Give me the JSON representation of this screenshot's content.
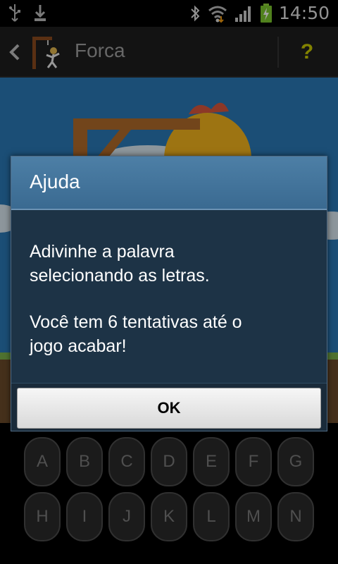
{
  "status_bar": {
    "time": "14:50",
    "left_icons": [
      "usb-icon",
      "download-icon"
    ],
    "right_icons": [
      "bluetooth-icon",
      "wifi-icon",
      "signal-icon",
      "battery-charging-icon"
    ]
  },
  "action_bar": {
    "title": "Forca",
    "help_label": "?",
    "icons": [
      "back-chevron-icon",
      "hangman-logo-icon"
    ]
  },
  "dialog": {
    "title": "Ajuda",
    "message_line1": "Adivinhe a palavra\nselecionando as letras.",
    "message_line2": "Você tem 6 tentativas até o\njogo acabar!",
    "ok_label": "OK"
  },
  "keyboard": {
    "row1": [
      "A",
      "B",
      "C",
      "D",
      "E",
      "F",
      "G"
    ],
    "row2": [
      "H",
      "I",
      "J",
      "K",
      "L",
      "M",
      "N"
    ]
  },
  "colors": {
    "accent_help": "#c8c800",
    "dialog_header": "#4d7fa6",
    "dialog_body": "#1d3346",
    "game_bg": "#2a78b5"
  }
}
